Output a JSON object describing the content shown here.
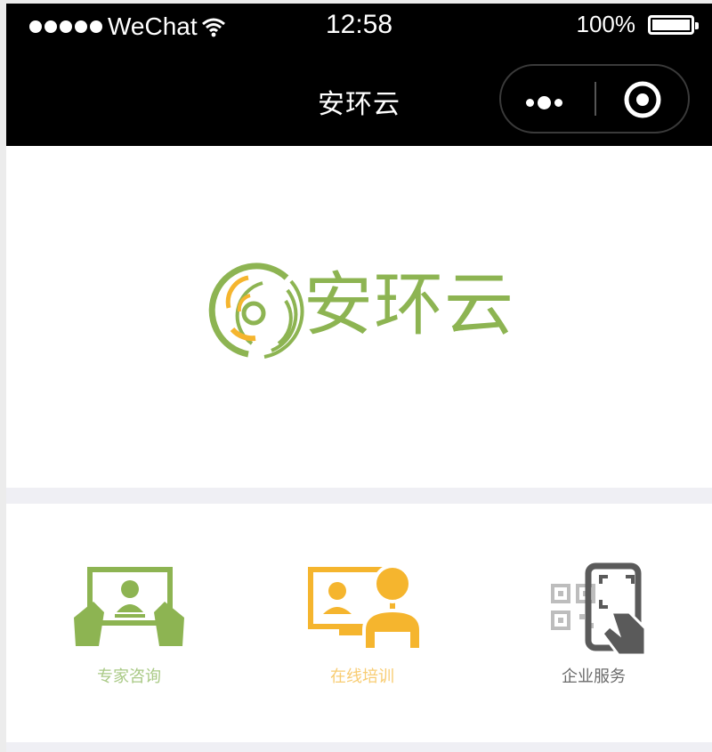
{
  "status_bar": {
    "carrier": "WeChat",
    "time": "12:58",
    "battery": "100%"
  },
  "nav": {
    "title": "安环云"
  },
  "brand": {
    "logo_text": "安环云",
    "colors": {
      "green": "#8db452",
      "yellow": "#f5b52e",
      "gray": "#5a5a5a"
    }
  },
  "services": [
    {
      "label": "专家咨询",
      "icon": "consult-icon",
      "color": "#8db452"
    },
    {
      "label": "在线培训",
      "icon": "training-icon",
      "color": "#f5b52e"
    },
    {
      "label": "企业服务",
      "icon": "qr-scan-icon",
      "color": "#5a5a5a"
    }
  ]
}
